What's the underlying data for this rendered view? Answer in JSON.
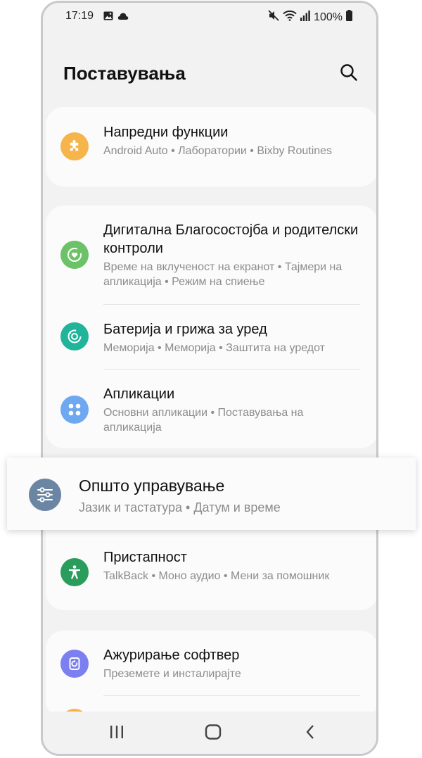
{
  "status_bar": {
    "time": "17:19",
    "battery": "100%",
    "left_icons": [
      "image-icon",
      "cloud-icon"
    ],
    "right_icons": [
      "mute-icon",
      "wifi-icon",
      "signal-icon",
      "battery-icon"
    ]
  },
  "header": {
    "title": "Поставувања",
    "search_icon": "search-icon"
  },
  "cards": [
    {
      "items": [
        {
          "title": "Напредни функции",
          "subtitle": "Android Auto  •  Лаборатории  •  Bixby Routines",
          "icon": "puzzle-icon",
          "color": "#f6b54a"
        }
      ]
    },
    {
      "items": [
        {
          "title": "Дигитална Благосостојба и родителски контроли",
          "subtitle": "Време на вклученост на екранот  •  Тајмери на апликација  •  Режим на спиење",
          "icon": "wellbeing-icon",
          "color": "#6cc266"
        },
        {
          "title": "Батерија и грижа за уред",
          "subtitle": "Меморија  •  Меморија  •  Заштита на уредот",
          "icon": "device-care-icon",
          "color": "#20b49a"
        },
        {
          "title": "Апликации",
          "subtitle": "Основни апликации  •  Поставувања на апликација",
          "icon": "apps-icon",
          "color": "#6ea8f0"
        }
      ]
    },
    {
      "items": [
        {
          "title": "Општо управување",
          "subtitle": "Јазик и тастатура  •  Датум и време",
          "icon": "sliders-icon",
          "color": "#6b86a3"
        },
        {
          "title": "Пристапност",
          "subtitle": "TalkBack  •  Моно аудио  •  Мени за помошник",
          "icon": "accessibility-icon",
          "color": "#2a9d5c"
        }
      ]
    },
    {
      "items": [
        {
          "title": "Ажурирање софтвер",
          "subtitle": "Преземете и инсталирајте",
          "icon": "update-icon",
          "color": "#7b7ff0"
        }
      ]
    }
  ],
  "navigation": [
    "recents-icon",
    "home-icon",
    "back-icon"
  ]
}
